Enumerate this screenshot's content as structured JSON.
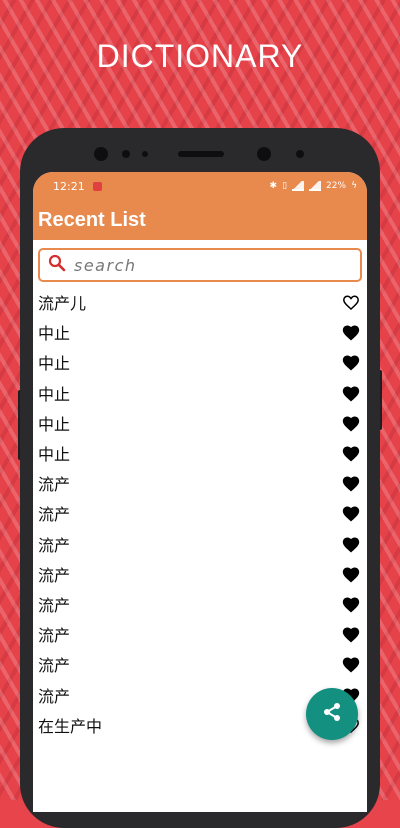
{
  "banner": {
    "title": "DICTIONARY"
  },
  "statusbar": {
    "time": "12:21",
    "battery": "22%"
  },
  "appbar": {
    "title": "Recent List"
  },
  "search": {
    "placeholder": "search",
    "value": ""
  },
  "recent": [
    {
      "word": "流产儿",
      "favorite": false
    },
    {
      "word": "中止",
      "favorite": true
    },
    {
      "word": "中止",
      "favorite": true
    },
    {
      "word": "中止",
      "favorite": true
    },
    {
      "word": "中止",
      "favorite": true
    },
    {
      "word": "中止",
      "favorite": true
    },
    {
      "word": "流产",
      "favorite": true
    },
    {
      "word": "流产",
      "favorite": true
    },
    {
      "word": "流产",
      "favorite": true
    },
    {
      "word": "流产",
      "favorite": true
    },
    {
      "word": "流产",
      "favorite": true
    },
    {
      "word": "流产",
      "favorite": true
    },
    {
      "word": "流产",
      "favorite": true
    },
    {
      "word": "流产",
      "favorite": true
    },
    {
      "word": "在生产中",
      "favorite": false
    }
  ],
  "colors": {
    "appbar": "#e8894e",
    "fab": "#139080",
    "background": "#e6424a"
  },
  "icons": {
    "search": "search-icon",
    "favorite": "heart-icon",
    "share": "share-icon"
  }
}
